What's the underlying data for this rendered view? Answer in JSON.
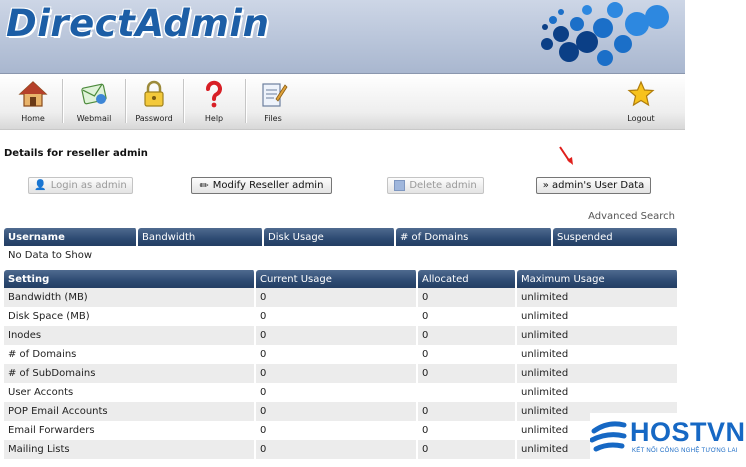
{
  "brand": {
    "logo_text": "DirectAdmin"
  },
  "toolbar": {
    "items": [
      {
        "label": "Home",
        "icon": "home-icon"
      },
      {
        "label": "Webmail",
        "icon": "webmail-icon"
      },
      {
        "label": "Password",
        "icon": "lock-icon"
      },
      {
        "label": "Help",
        "icon": "question-icon"
      },
      {
        "label": "Files",
        "icon": "files-icon"
      }
    ],
    "logout_label": "Logout"
  },
  "page_title": "Details for reseller admin",
  "actions": {
    "login_as": "Login as admin",
    "modify": "Modify Reseller admin",
    "delete": "Delete admin",
    "user_data": "» admin's User Data"
  },
  "advanced_search": "Advanced Search",
  "users_table": {
    "headers": [
      "Username",
      "Bandwidth",
      "Disk Usage",
      "# of Domains",
      "Suspended"
    ],
    "empty_message": "No Data to Show"
  },
  "usage_table": {
    "headers": [
      "Setting",
      "Current Usage",
      "Allocated",
      "Maximum Usage"
    ],
    "rows": [
      [
        "Bandwidth (MB)",
        "0",
        "0",
        "unlimited"
      ],
      [
        "Disk Space (MB)",
        "0",
        "0",
        "unlimited"
      ],
      [
        "Inodes",
        "0",
        "0",
        "unlimited"
      ],
      [
        "# of Domains",
        "0",
        "0",
        "unlimited"
      ],
      [
        "# of SubDomains",
        "0",
        "0",
        "unlimited"
      ],
      [
        "User Acconts",
        "0",
        "",
        "unlimited"
      ],
      [
        "POP Email Accounts",
        "0",
        "0",
        "unlimited"
      ],
      [
        "Email Forwarders",
        "0",
        "0",
        "unlimited"
      ],
      [
        "Mailing Lists",
        "0",
        "0",
        "unlimited"
      ]
    ]
  },
  "watermark": {
    "name": "HOSTVN",
    "tagline": "KẾT NỐI CÔNG NGHỆ TƯƠNG LAI"
  },
  "colors": {
    "header_blue": "#1c5ea6",
    "table_header": "#2d4a72",
    "arrow_red": "#e0201c"
  }
}
